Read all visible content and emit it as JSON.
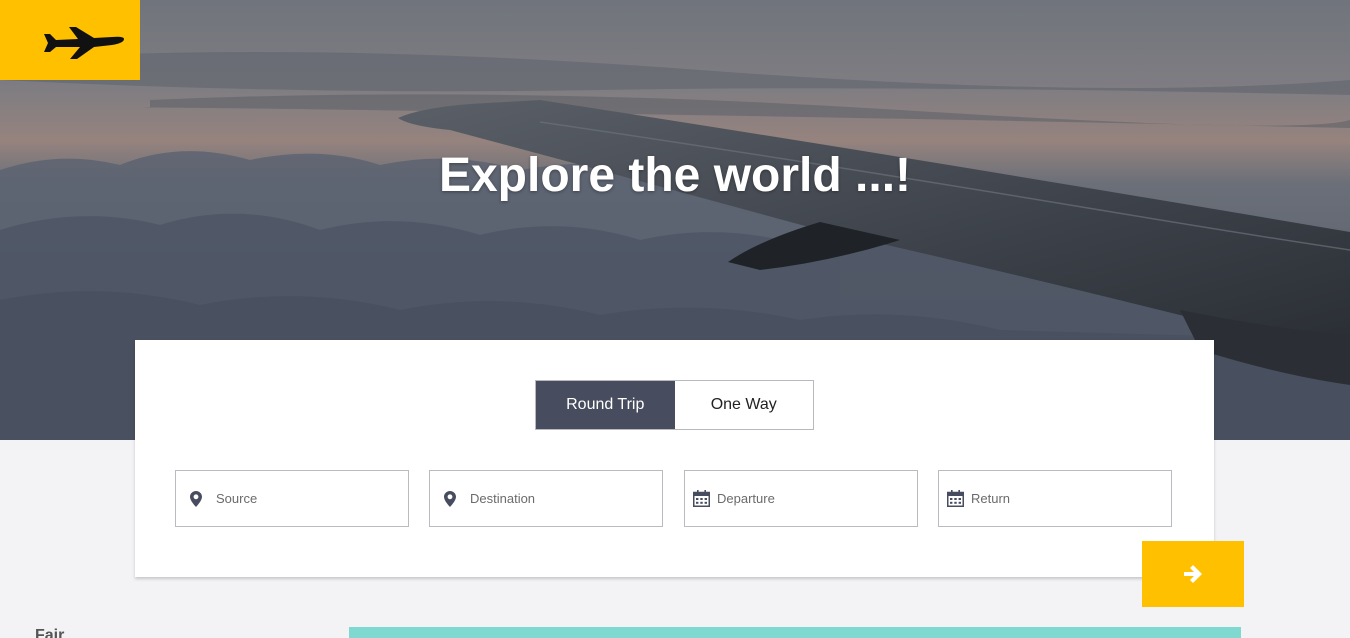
{
  "hero": {
    "headline": "Explore the world ...!"
  },
  "logo": {
    "icon": "airplane-icon"
  },
  "trip_type": {
    "options": [
      "Round Trip",
      "One Way"
    ],
    "selected": "Round Trip"
  },
  "search": {
    "source": {
      "placeholder": "Source",
      "icon": "map-pin-icon"
    },
    "destination": {
      "placeholder": "Destination",
      "icon": "map-pin-icon"
    },
    "departure": {
      "placeholder": "Departure",
      "icon": "calendar-icon"
    },
    "return": {
      "placeholder": "Return",
      "icon": "calendar-icon"
    }
  },
  "submit": {
    "icon": "arrow-right-icon"
  },
  "below": {
    "section_label": "Fair"
  },
  "colors": {
    "accent": "#ffc000",
    "active_tab": "#474d5e",
    "strip": "#7fd9d0",
    "background": "#f3f3f5"
  }
}
